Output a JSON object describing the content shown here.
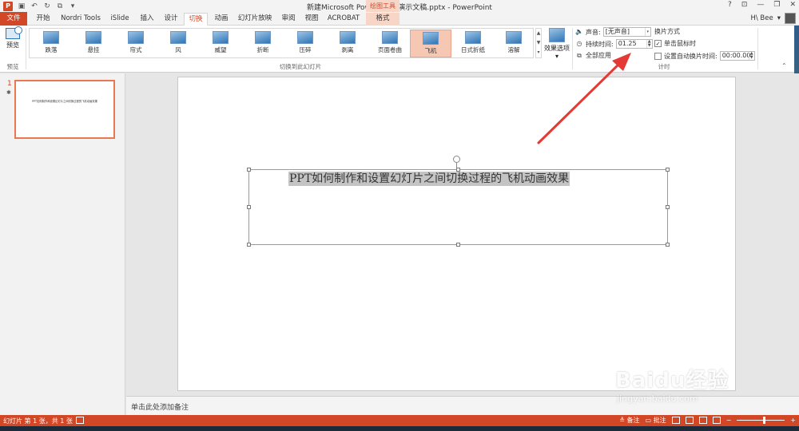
{
  "window": {
    "title": "新建Microsoft PowerPoint 演示文稿.pptx - PowerPoint",
    "contextual_tab_group": "绘图工具",
    "controls": [
      "?",
      "⊡",
      "—",
      "❐",
      "✕"
    ]
  },
  "tabs": [
    {
      "label": "文件"
    },
    {
      "label": "开始"
    },
    {
      "label": "Nordri Tools"
    },
    {
      "label": "iSlide"
    },
    {
      "label": "插入"
    },
    {
      "label": "设计"
    },
    {
      "label": "切换"
    },
    {
      "label": "动画"
    },
    {
      "label": "幻灯片放映"
    },
    {
      "label": "审阅"
    },
    {
      "label": "视图"
    },
    {
      "label": "ACROBAT"
    },
    {
      "label": "格式"
    }
  ],
  "user": {
    "name": "H\\ Bee",
    "dropdown": "▾"
  },
  "ribbon": {
    "preview": {
      "button_label": "预览",
      "group_label": "预览"
    },
    "transitions": {
      "group_label": "切换到此幻灯片",
      "items": [
        "跌落",
        "悬挂",
        "帘式",
        "风",
        "威望",
        "折断",
        "压碎",
        "剥离",
        "页面卷曲",
        "飞机",
        "日式折纸",
        "溶解"
      ],
      "selected": "飞机"
    },
    "effect_options": {
      "label": "效果选项",
      "arrow": "▾"
    },
    "timing": {
      "group_label": "计时",
      "sound_label": "声音:",
      "sound_value": "[无声音]",
      "duration_label": "持续时间:",
      "duration_value": "01.25",
      "apply_all_label": "全部应用",
      "advance_heading": "换片方式",
      "on_click_label": "单击鼠标时",
      "on_click_checked": true,
      "after_label": "设置自动换片时间:",
      "after_checked": false,
      "after_value": "00:00.00"
    }
  },
  "slides_panel": {
    "slide_number": "1",
    "star": "✱",
    "thumbnail_text": "PPT如何制作和设置幻灯片之间切换过程的飞机动画效果"
  },
  "slide": {
    "title": "PPT如何制作和设置幻灯片之间切换过程的飞机动画效果"
  },
  "notes": {
    "placeholder": "单击此处添加备注"
  },
  "statusbar": {
    "slide_info": "幻灯片 第 1 张，共 1 张",
    "notes_label": "备注",
    "comments_label": "批注"
  },
  "watermark": {
    "main": "Baidu经验",
    "sub": "jingyan.baidu.com"
  },
  "colors": {
    "accent": "#d24726",
    "selected_transition": "#f6c8b4",
    "arrow": "#e53935"
  }
}
